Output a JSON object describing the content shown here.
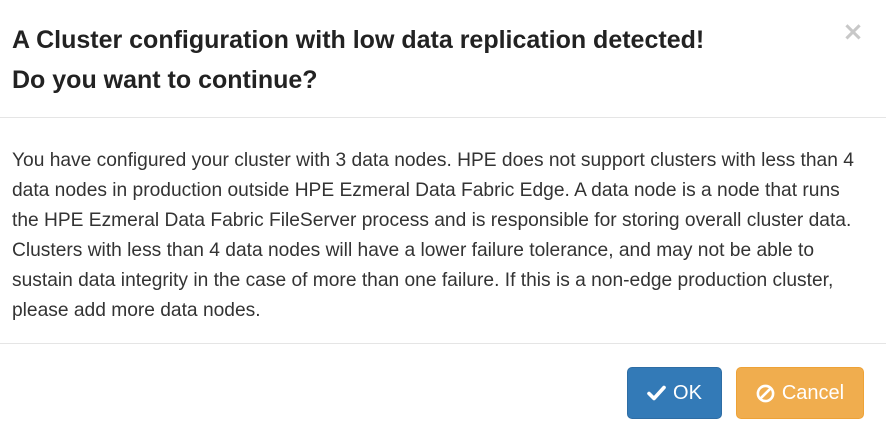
{
  "dialog": {
    "title_line1": "A Cluster configuration with low data replication detected!",
    "title_line2": "Do you want to continue?",
    "close_glyph": "×",
    "body_text": "You have configured your cluster with 3 data nodes. HPE does not support clusters with less than 4 data nodes in production outside HPE Ezmeral Data Fabric Edge. A data node is a node that runs the HPE Ezmeral Data Fabric FileServer process and is responsible for storing overall cluster data. Clusters with less than 4 data nodes will have a lower failure tolerance, and may not be able to sustain data integrity in the case of more than one failure. If this is a non-edge production cluster, please add more data nodes."
  },
  "buttons": {
    "ok": {
      "label": "OK",
      "icon": "check-icon",
      "color": "#337ab7"
    },
    "cancel": {
      "label": "Cancel",
      "icon": "ban-icon",
      "color": "#f0ad4e"
    }
  }
}
